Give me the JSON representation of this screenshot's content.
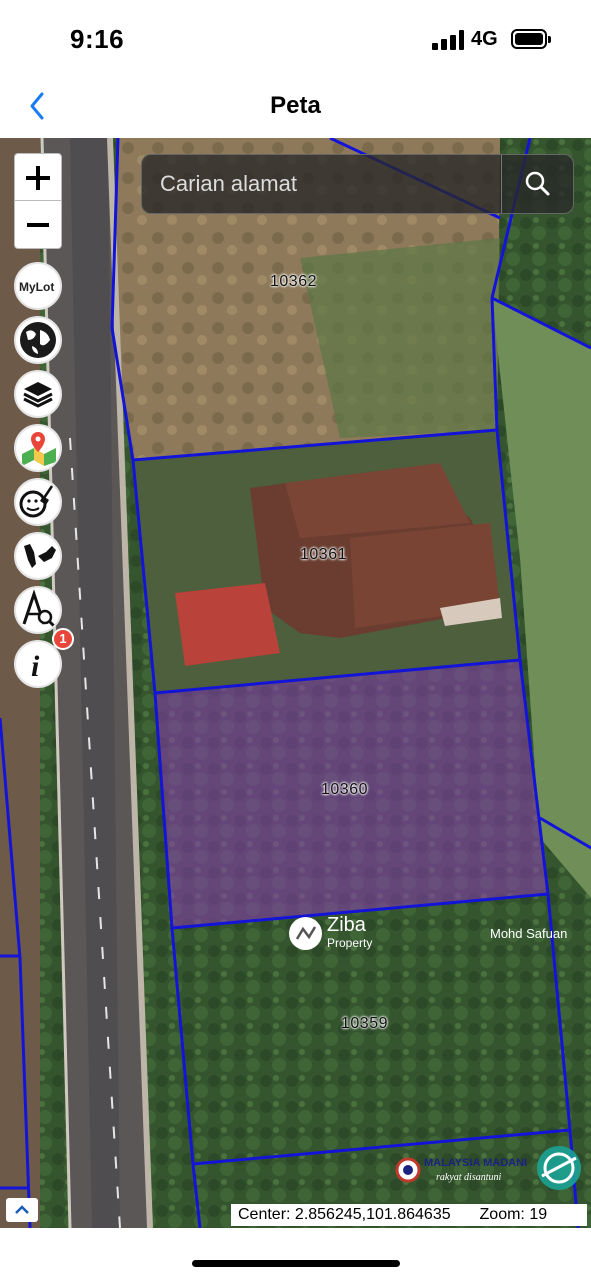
{
  "status_bar": {
    "time": "9:16",
    "network": "4G"
  },
  "nav": {
    "title": "Peta"
  },
  "search": {
    "placeholder": "Carian alamat"
  },
  "map": {
    "lots": [
      "10362",
      "10361",
      "10360",
      "10359"
    ],
    "watermark": {
      "name": "Ziba",
      "sub": "Property"
    },
    "credit": "Mohd Safuan",
    "logo_text": {
      "main": "MALAYSIA MADANI",
      "tagline": "rakyat disantuni"
    },
    "info_badge_count": "1",
    "coordinates": "Center: 2.856245,101.864635",
    "zoom": "Zoom: 19"
  },
  "tools": [
    {
      "name": "mylot",
      "label": "MyLot"
    },
    {
      "name": "globe"
    },
    {
      "name": "layers"
    },
    {
      "name": "map-pin"
    },
    {
      "name": "clean"
    },
    {
      "name": "malaysia"
    },
    {
      "name": "measure-search"
    },
    {
      "name": "info"
    }
  ],
  "colors": {
    "lot_boundary": "#1414d8",
    "highlight": "#8a3cb5",
    "badge": "#e8463a"
  }
}
